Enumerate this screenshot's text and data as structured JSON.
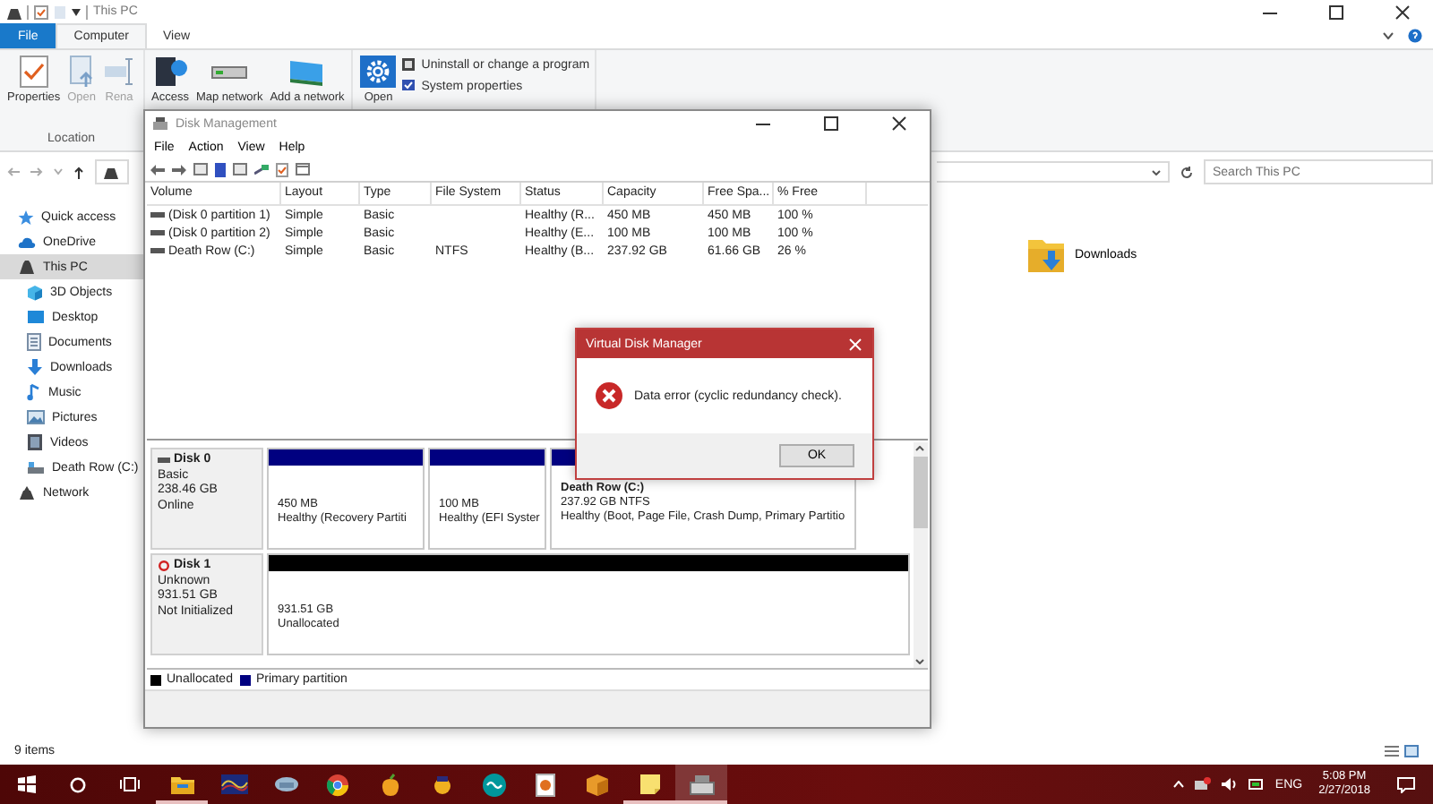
{
  "explorer": {
    "title": "This PC",
    "ribbon_tabs": [
      {
        "label": "File",
        "selected": false,
        "kind": "file"
      },
      {
        "label": "Computer",
        "selected": true,
        "kind": "tab"
      },
      {
        "label": "View",
        "selected": false,
        "kind": "tab"
      }
    ],
    "ribbon_groups": [
      {
        "label": "Location",
        "buttons": [
          {
            "label": "Properties",
            "disabled": false
          },
          {
            "label": "Open",
            "disabled": true
          },
          {
            "label": "Rena",
            "disabled": true
          }
        ]
      },
      {
        "buttons": [
          {
            "label": "Access",
            "disabled": false
          },
          {
            "label": "Map network",
            "disabled": false
          },
          {
            "label": "Add a network",
            "disabled": false
          }
        ]
      },
      {
        "buttons": [
          {
            "label": "Open",
            "disabled": false
          }
        ],
        "small_buttons": [
          "Uninstall or change a program",
          "System properties"
        ]
      }
    ],
    "search": {
      "placeholder": "Search This PC"
    },
    "nav": [
      {
        "label": "Quick access",
        "selected": false
      },
      {
        "label": "OneDrive",
        "selected": false
      },
      {
        "label": "This PC",
        "selected": true,
        "children": [
          {
            "label": "3D Objects",
            "selected": false
          },
          {
            "label": "Desktop",
            "selected": false
          },
          {
            "label": "Documents",
            "selected": false
          },
          {
            "label": "Downloads",
            "selected": false
          },
          {
            "label": "Music",
            "selected": false
          },
          {
            "label": "Pictures",
            "selected": false
          },
          {
            "label": "Videos",
            "selected": false
          },
          {
            "label": "Death Row (C:)",
            "selected": false
          }
        ]
      },
      {
        "label": "Network",
        "selected": false
      }
    ],
    "items": [
      {
        "label": "Downloads"
      }
    ],
    "status": "9 items"
  },
  "disk_management": {
    "title": "Disk Management",
    "menu": [
      "File",
      "Action",
      "View",
      "Help"
    ],
    "columns": [
      "Volume",
      "Layout",
      "Type",
      "File System",
      "Status",
      "Capacity",
      "Free Spa...",
      "% Free"
    ],
    "rows": [
      [
        "(Disk 0 partition 1)",
        "Simple",
        "Basic",
        "",
        "Healthy (R...",
        "450 MB",
        "450 MB",
        "100 %"
      ],
      [
        "(Disk 0 partition 2)",
        "Simple",
        "Basic",
        "",
        "Healthy (E...",
        "100 MB",
        "100 MB",
        "100 %"
      ],
      [
        "Death Row (C:)",
        "Simple",
        "Basic",
        "NTFS",
        "Healthy (B...",
        "237.92 GB",
        "61.66 GB",
        "26 %"
      ]
    ],
    "disks": [
      {
        "name": "Disk 0",
        "kind": "online",
        "lines": [
          "Basic",
          "238.46 GB",
          "Online"
        ],
        "partitions": [
          {
            "kind": "primary",
            "lines": [
              "450 MB",
              "Healthy (Recovery Partiti"
            ]
          },
          {
            "kind": "primary",
            "lines": [
              "100 MB",
              "Healthy (EFI Syster"
            ]
          },
          {
            "kind": "primary",
            "title": "Death Row  (C:)",
            "lines": [
              "237.92 GB NTFS",
              "Healthy (Boot, Page File, Crash Dump, Primary Partitio"
            ]
          }
        ]
      },
      {
        "name": "Disk 1",
        "kind": "not_initialized",
        "lines": [
          "Unknown",
          "931.51 GB",
          "Not Initialized"
        ],
        "partitions": [
          {
            "kind": "unallocated",
            "lines": [
              "931.51 GB",
              "Unallocated"
            ]
          }
        ]
      }
    ],
    "legend": [
      {
        "label": "Unallocated",
        "color": "#000000"
      },
      {
        "label": "Primary partition",
        "color": "#000080"
      }
    ]
  },
  "dialog": {
    "title": "Virtual Disk Manager",
    "message": "Data error (cyclic redundancy check).",
    "button": "OK"
  },
  "taskbar": {
    "apps": [
      {
        "open": true,
        "selected": false
      },
      {
        "open": false,
        "selected": false
      },
      {
        "open": false,
        "selected": false
      },
      {
        "open": false,
        "selected": false
      },
      {
        "open": false,
        "selected": false
      },
      {
        "open": false,
        "selected": false
      },
      {
        "open": false,
        "selected": false
      },
      {
        "open": false,
        "selected": false
      },
      {
        "open": false,
        "selected": false
      },
      {
        "open": true,
        "selected": false
      },
      {
        "open": true,
        "selected": true
      }
    ],
    "language": "ENG",
    "time": "5:08 PM",
    "date": "2/27/2018"
  }
}
